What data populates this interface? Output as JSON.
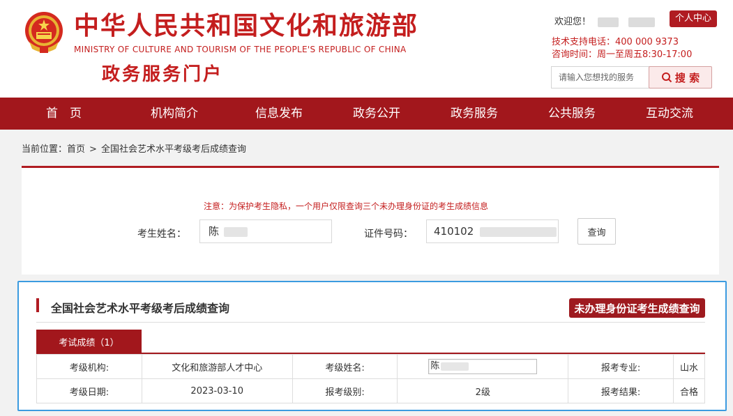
{
  "header": {
    "title": "中华人民共和国文化和旅游部",
    "subtitle": "MINISTRY OF CULTURE AND TOURISM OF THE PEOPLE'S REPUBLIC OF CHINA",
    "portal": "政务服务门户",
    "welcome": "欢迎您！",
    "user_center": "个人中心",
    "support_phone": "技术支持电话：400 000 9373",
    "service_hours": "咨询时间：周一至周五8:30-17:00",
    "search_placeholder": "请输入您想找的服务",
    "search_button": "搜 索"
  },
  "nav": {
    "items": [
      "首　页",
      "机构简介",
      "信息发布",
      "政务公开",
      "政务服务",
      "公共服务",
      "互动交流"
    ]
  },
  "breadcrumb": {
    "prefix": "当前位置：",
    "home": "首页",
    "separator": ">",
    "current": "全国社会艺术水平考级考后成绩查询"
  },
  "query": {
    "notice": "注意：为保护考生隐私，一个用户仅限查询三个未办理身份证的考生成绩信息",
    "name_label": "考生姓名：",
    "name_value": "陈",
    "id_label": "证件号码：",
    "id_value": "410102",
    "query_button": "查询"
  },
  "results": {
    "title": "全国社会艺术水平考级考后成绩查询",
    "no_id_button": "未办理身份证考生成绩查询",
    "tab_label": "考试成绩（1）",
    "rows": [
      [
        "考级机构:",
        "文化和旅游部人才中心",
        "考级姓名:",
        "陈",
        "报考专业:",
        "山水"
      ],
      [
        "考级日期:",
        "2023-03-10",
        "报考级别:",
        "2级",
        "报考结果:",
        "合格"
      ]
    ]
  },
  "colors": {
    "brand_red": "#a2171c",
    "title_red": "#c41e1e",
    "highlight_blue": "#3b9be0"
  }
}
